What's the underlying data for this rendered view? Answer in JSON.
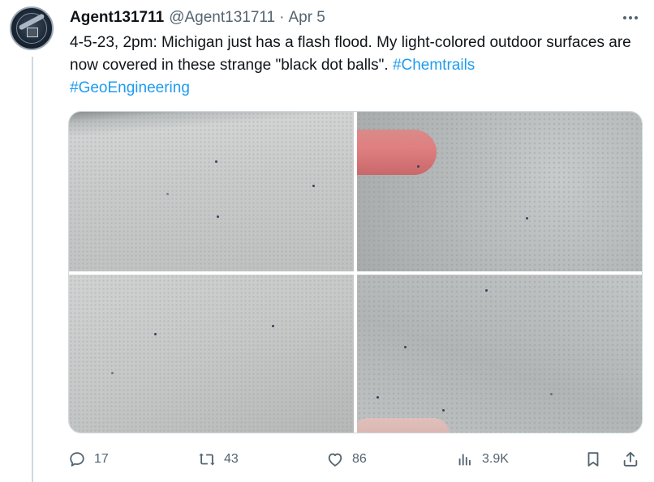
{
  "tweet": {
    "author_name": "Agent131711",
    "handle": "@Agent131711",
    "separator": "·",
    "date": "Apr 5",
    "text_main": "4-5-23, 2pm:  Michigan just has a flash flood.  My light-colored outdoor surfaces are now covered in these strange \"black dot balls\".  ",
    "hashtag1": "#Chemtrails",
    "hashtag2": "#GeoEngineering"
  },
  "actions": {
    "replies": "17",
    "retweets": "43",
    "likes": "86",
    "views": "3.9K"
  },
  "icons": {
    "avatar": "profile-avatar-emblem",
    "more": "more-options-icon",
    "reply": "reply-icon",
    "retweet": "retweet-icon",
    "like": "heart-icon",
    "views": "analytics-icon",
    "bookmark": "bookmark-icon",
    "share": "share-icon"
  },
  "colors": {
    "link": "#1d9bf0",
    "secondary_text": "#536471",
    "primary_text": "#0f1419"
  }
}
